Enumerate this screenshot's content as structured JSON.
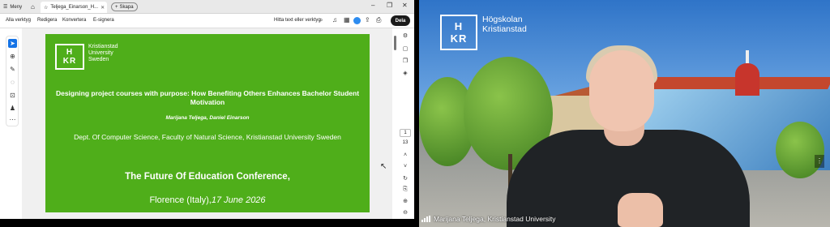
{
  "viewer": {
    "tabbar": {
      "menu_label": "Meny",
      "tab_title": "Teljega_Einarson_H...",
      "create_label": "Skapa",
      "window_controls": [
        "–",
        "❐",
        "✕"
      ]
    },
    "toolbar": {
      "items": [
        "Alla verktyg",
        "Redigera",
        "Konvertera",
        "E-signera"
      ],
      "search_label": "Hitta text eller verktyg",
      "share_label": "Dela"
    },
    "page_number": "1",
    "page_total": "13",
    "document": {
      "logo_letters": [
        "H",
        "KR"
      ],
      "logo_text": [
        "Kristianstad",
        "University",
        "Sweden"
      ],
      "title": "Designing project courses with purpose: How Benefiting Others Enhances Bachelor Student Motivation",
      "authors": "Marijana Teljega, Daniel Einarson",
      "department": "Dept. Of Computer Science, Faculty of Natural Science, Kristianstad University Sweden",
      "conference": "The Future Of Education Conference,",
      "place": "Florence (Italy),",
      "date": "17 June 2026"
    }
  },
  "video": {
    "logo_letters": [
      "H",
      "KR"
    ],
    "institution": [
      "Högskolan",
      "Kristianstad"
    ],
    "participant_name": "Marijana Teljega, Kristianstad University"
  },
  "colors": {
    "slide_green": "#4fae1a",
    "share_button": "#1b1b1b",
    "select_tool": "#1473e6"
  }
}
